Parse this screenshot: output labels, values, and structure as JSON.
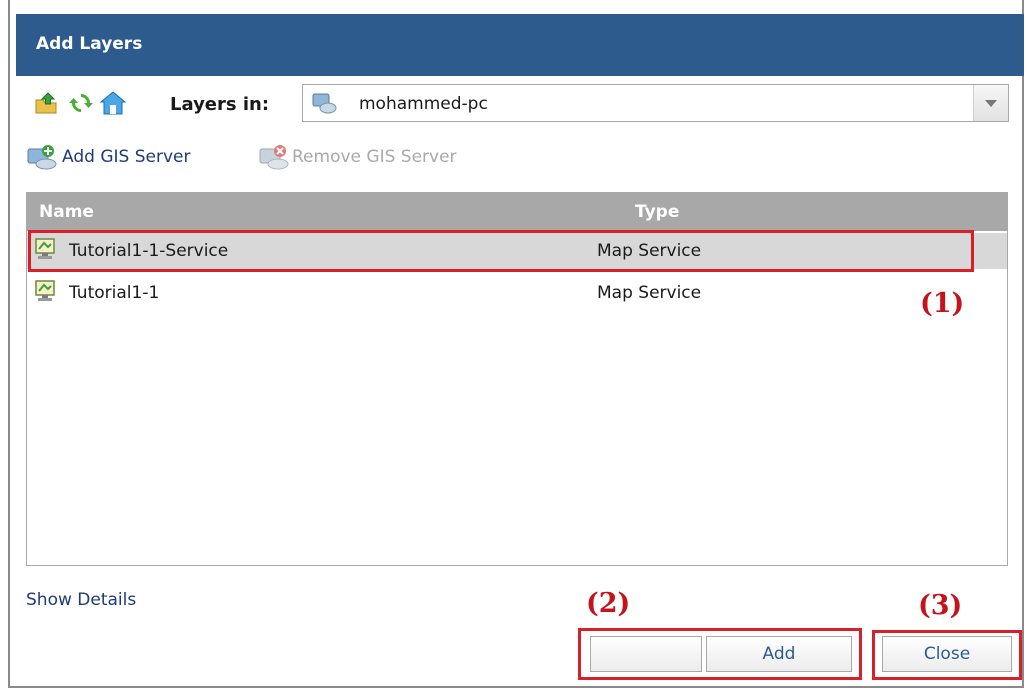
{
  "dialog": {
    "title": "Add Layers"
  },
  "toolbar": {
    "icons": [
      "folder-up-icon",
      "refresh-icon",
      "home-icon"
    ],
    "layers_in_label": "Layers in:",
    "server_select": {
      "value": "mohammed-pc",
      "icon": "server-icon"
    }
  },
  "server_actions": {
    "add_label": "Add GIS Server",
    "remove_label": "Remove GIS Server"
  },
  "list": {
    "columns": [
      "Name",
      "Type"
    ],
    "rows": [
      {
        "name": "Tutorial1-1-Service",
        "type": "Map Service",
        "selected": true
      },
      {
        "name": "Tutorial1-1",
        "type": "Map Service",
        "selected": false
      }
    ]
  },
  "footer": {
    "show_details": "Show Details",
    "add_label": "Add",
    "close_label": "Close"
  },
  "annotations": [
    "(1)",
    "(2)",
    "(3)"
  ],
  "colors": {
    "title_bar": "#2d5b8e",
    "header": "#a8a8a8",
    "highlight": "#d8202a"
  }
}
